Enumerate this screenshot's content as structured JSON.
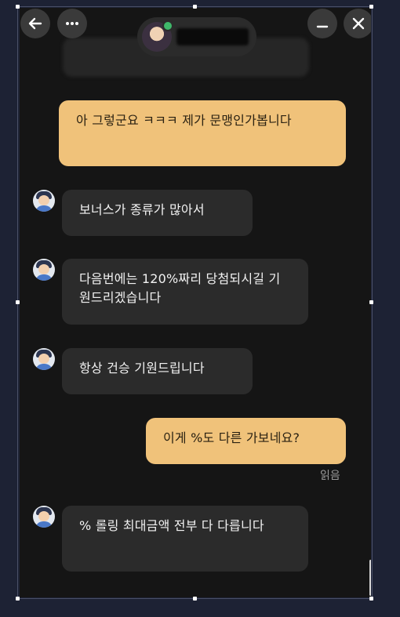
{
  "header": {
    "back_icon": "arrow-left-icon",
    "more_icon": "more-horizontal-icon",
    "minimize_icon": "minimize-icon",
    "close_icon": "close-icon"
  },
  "messages": [
    {
      "sender": "me",
      "text": "아 그렇군요 ㅋㅋㅋ 제가 문맹인가봅니다"
    },
    {
      "sender": "agent",
      "text": "보너스가 종류가 많아서"
    },
    {
      "sender": "agent",
      "text": "다음번에는 120%짜리 당첨되시길 기원드리겠습니다"
    },
    {
      "sender": "agent",
      "text": "항상 건승 기원드립니다"
    },
    {
      "sender": "me",
      "text": "이게 %도 다른 가보네요?",
      "status": "읽음"
    },
    {
      "sender": "agent",
      "text": "% 롤링 최대금액 전부 다 다릅니다"
    }
  ],
  "colors": {
    "my_bubble": "#f0c27a",
    "their_bubble": "#2b2b2b",
    "background": "#151515"
  }
}
